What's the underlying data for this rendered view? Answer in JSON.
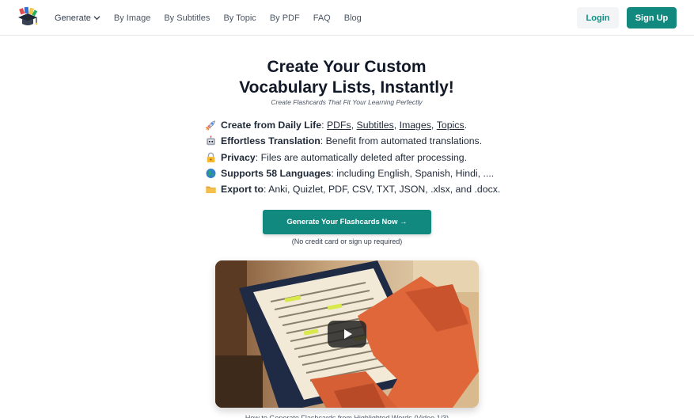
{
  "header": {
    "nav": [
      {
        "label": "Generate",
        "has_dropdown": true
      },
      {
        "label": "By Image"
      },
      {
        "label": "By Subtitles"
      },
      {
        "label": "By Topic"
      },
      {
        "label": "By PDF"
      },
      {
        "label": "FAQ"
      },
      {
        "label": "Blog"
      }
    ],
    "login_label": "Login",
    "signup_label": "Sign Up"
  },
  "hero": {
    "title_line1": "Create Your Custom",
    "title_line2": "Vocabulary Lists, Instantly!",
    "subtitle": "Create Flashcards That Fit Your Learning Perfectly",
    "features": [
      {
        "icon": "rocket-icon",
        "bold": "Create from Daily Life",
        "sep": ": ",
        "links": [
          "PDFs",
          "Subtitles",
          "Images",
          "Topics"
        ],
        "end": "."
      },
      {
        "icon": "robot-icon",
        "bold": "Effortless Translation",
        "text": ": Benefit from automated translations."
      },
      {
        "icon": "lock-icon",
        "bold": "Privacy",
        "text": ": Files are automatically deleted after processing."
      },
      {
        "icon": "globe-icon",
        "bold": "Supports 58 Languages",
        "text": ": including English, Spanish, Hindi, ...."
      },
      {
        "icon": "folder-icon",
        "bold": "Export to",
        "text": ": Anki, Quizlet, PDF, CSV, TXT, JSON, .xlsx, and .docx."
      }
    ],
    "cta_label": "Generate Your Flashcards Now →",
    "cta_note": "(No credit card or sign up required)"
  },
  "video": {
    "caption": "How to Generate Flashcards from Highlighted Words (Video 1/3)"
  },
  "colors": {
    "brand": "#11897f",
    "text": "#1f2937"
  }
}
